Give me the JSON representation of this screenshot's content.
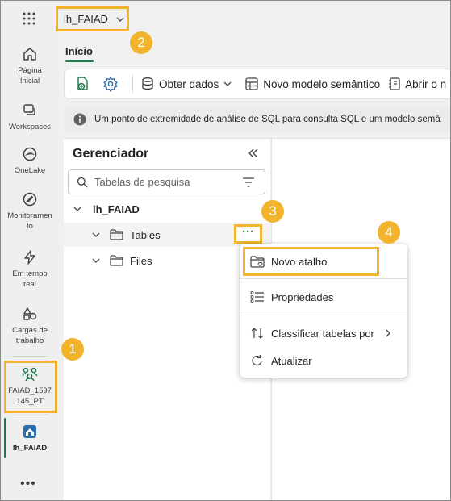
{
  "app": {
    "workspace_name": "lh_FAIAD"
  },
  "rail": {
    "items": [
      {
        "label": "Página Inicial",
        "icon": "home-icon"
      },
      {
        "label": "Workspaces",
        "icon": "workspaces-icon"
      },
      {
        "label": "OneLake",
        "icon": "onelake-icon"
      },
      {
        "label": "Monitoramento",
        "icon": "monitor-icon"
      },
      {
        "label": "Em tempo real",
        "icon": "realtime-icon"
      },
      {
        "label": "Cargas de trabalho",
        "icon": "workloads-icon"
      },
      {
        "label": "FAIAD_1597145_PT",
        "icon": "workspace-group-icon"
      },
      {
        "label": "lh_FAIAD",
        "icon": "lakehouse-icon"
      }
    ],
    "more": "•••"
  },
  "tabs": {
    "home": "Início"
  },
  "toolbar": {
    "get_data": "Obter dados",
    "new_semantic_model": "Novo modelo semântico",
    "open_notebook": "Abrir o n"
  },
  "banner": {
    "text": "Um ponto de extremidade de análise de SQL para consulta SQL e um modelo semâ"
  },
  "explorer": {
    "title": "Gerenciador",
    "search_placeholder": "Tabelas de pesquisa",
    "tree": {
      "root": "lh_FAIAD",
      "tables": "Tables",
      "files": "Files",
      "more": "···"
    }
  },
  "context_menu": {
    "new_shortcut": "Novo atalho",
    "properties": "Propriedades",
    "sort_tables": "Classificar tabelas por",
    "refresh": "Atualizar"
  },
  "callouts": [
    "1",
    "2",
    "3",
    "4"
  ],
  "colors": {
    "highlight": "#f2b42c",
    "accent_green": "#1f7a4d"
  }
}
